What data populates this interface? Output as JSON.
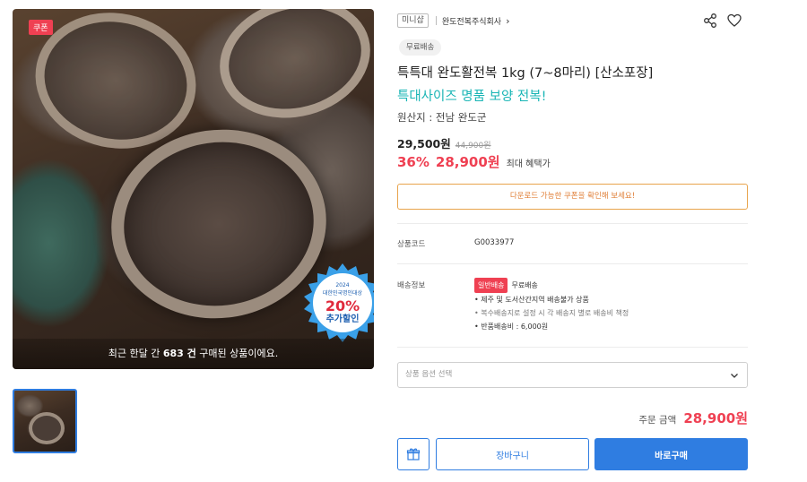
{
  "gallery": {
    "coupon_badge": "쿠폰",
    "seal_lines": [
      "2024",
      "대한민국명인대상",
      "20%",
      "추가할인"
    ],
    "purchase_prefix": "최근 한달 간 ",
    "purchase_count": "683 건",
    "purchase_suffix": " 구매된 상품이에요."
  },
  "brand": {
    "tag": "미니샵",
    "seller": "완도전복주식회사"
  },
  "product": {
    "shipping_chip": "무료배송",
    "title": "특특대 완도활전복 1kg (7~8마리) [산소포장]",
    "subtitle": "특대사이즈 명품 보양 전복!",
    "origin": "원산지 : 전남 완도군"
  },
  "price": {
    "current": "29,500원",
    "original": "44,900원",
    "discount_rate": "36%",
    "sale_price": "28,900원",
    "benefit_label": "최대 혜택가"
  },
  "coupon_notice": "다운로드 가능한 쿠폰을 확인해 보세요!",
  "details": {
    "code_label": "상품코드",
    "code_value": "G0033977",
    "shipping_label": "배송정보",
    "shipping_tag": "일반배송",
    "shipping_type": "무료배송",
    "shipping_notes": [
      "• 제주 및 도서산간지역 배송불가 상품",
      "• 복수배송지로 설정 시 각 배송지 별로 배송비 책정",
      "• 반품배송비 : 6,000원"
    ]
  },
  "option_select": {
    "placeholder": "상품 옵션 선택"
  },
  "order": {
    "total_label": "주문 금액",
    "total_value": "28,900원"
  },
  "actions": {
    "cart_label": "장바구니",
    "buy_label": "바로구매"
  },
  "colors": {
    "accent_blue": "#2f7de1",
    "sale_red": "#ef4052",
    "subtitle_teal": "#19b5b5",
    "coupon_orange": "#e0803a"
  },
  "icons": [
    "share-icon",
    "heart-icon",
    "chevron-right-icon",
    "chevron-down-icon",
    "gift-icon"
  ]
}
